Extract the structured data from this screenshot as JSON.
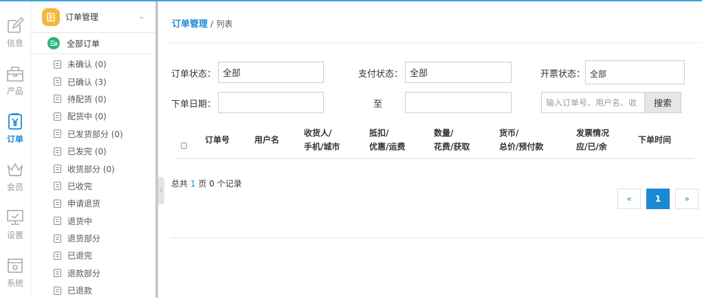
{
  "rail": [
    {
      "label": "信息",
      "icon": "edit-icon",
      "active": false
    },
    {
      "label": "产品",
      "icon": "bag-icon",
      "active": false
    },
    {
      "label": "订单",
      "icon": "order-yen-icon",
      "active": true
    },
    {
      "label": "会员",
      "icon": "crown-icon",
      "active": false
    },
    {
      "label": "设置",
      "icon": "monitor-check-icon",
      "active": false
    },
    {
      "label": "系统",
      "icon": "system-gear-icon",
      "active": false
    }
  ],
  "submenu": {
    "title": "订单管理",
    "all_label": "全部订单",
    "items": [
      "未确认 (0)",
      "已确认 (3)",
      "待配货 (0)",
      "配货中 (0)",
      "已发货部分 (0)",
      "已发完 (0)",
      "收货部分 (0)",
      "已收完",
      "申请退货",
      "退货中",
      "退货部分",
      "已退完",
      "退款部分",
      "已退款"
    ]
  },
  "breadcrumb": {
    "section": "订单管理",
    "separator": "/",
    "page": "列表"
  },
  "filters": {
    "order_status_label": "订单状态：",
    "order_status_value": "全部",
    "pay_status_label": "支付状态：",
    "pay_status_value": "全部",
    "invoice_status_label": "开票状态：",
    "invoice_status_value": "全部",
    "date_label": "下单日期：",
    "date_to": "至",
    "search_placeholder": "输入订单号、用户名、收",
    "search_button": "搜索"
  },
  "table": {
    "headers": [
      {
        "l1": "",
        "l2": "订单号"
      },
      {
        "l1": "",
        "l2": "用户名"
      },
      {
        "l1": "收货人/",
        "l2": "手机/城市"
      },
      {
        "l1": "抵扣/",
        "l2": "优惠/运费"
      },
      {
        "l1": "数量/",
        "l2": "花费/获取"
      },
      {
        "l1": "货币/",
        "l2": "总价/预付款"
      },
      {
        "l1": "发票情况",
        "l2": "应/已/余"
      },
      {
        "l1": "",
        "l2": "下单时间"
      }
    ]
  },
  "summary": {
    "prefix": "总共",
    "pages": "1",
    "middle": "页",
    "records": "0",
    "suffix": "个记录"
  },
  "pagination": {
    "prev": "«",
    "current": "1",
    "next": "»"
  },
  "colors": {
    "accent": "#1a8ad0",
    "menu_icon": "#f6b73c",
    "all_icon": "#29b37a"
  }
}
